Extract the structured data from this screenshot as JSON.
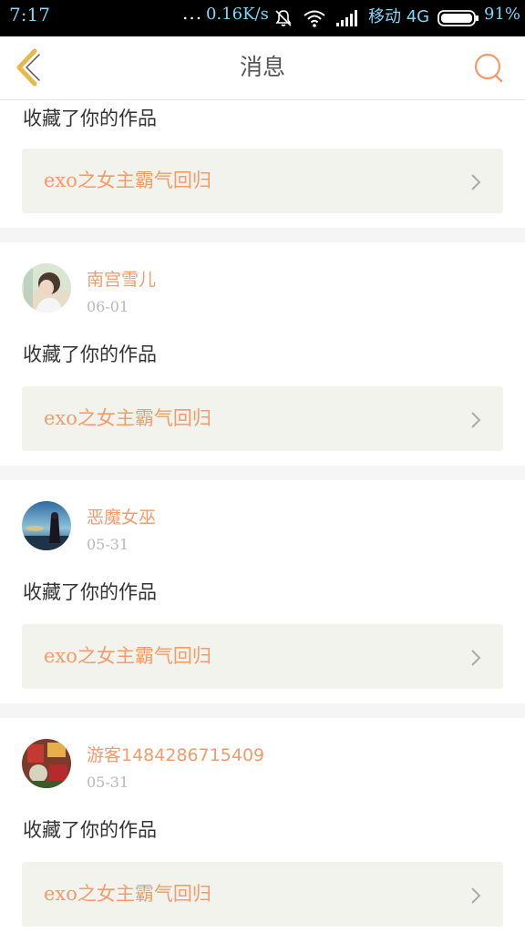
{
  "statusbar": {
    "time": "7:17",
    "dots": "...",
    "speed": "0.16K/s",
    "carrier": "移动 4G",
    "battery": "91%",
    "icons": [
      "mute-icon",
      "wifi-icon",
      "signal-icon",
      "battery-icon"
    ]
  },
  "navbar": {
    "title": "消息",
    "back_icon": "chevron-left-icon",
    "search_icon": "search-icon"
  },
  "colors": {
    "accent": "#f39b6b",
    "back_icon": "#e8b84a",
    "card_bg": "#f3f3ed",
    "separator": "#f5f5f5",
    "statusbar_text": "#7fd6f5"
  },
  "items": [
    {
      "action": "收藏了你的作品",
      "work": "exo之女主霸气回归"
    },
    {
      "name": "南宫雪儿",
      "date": "06-01",
      "action": "收藏了你的作品",
      "work": "exo之女主霸气回归"
    },
    {
      "name": "恶魔女巫",
      "date": "05-31",
      "action": "收藏了你的作品",
      "work": "exo之女主霸气回归"
    },
    {
      "name": "游客1484286715409",
      "date": "05-31",
      "action": "收藏了你的作品",
      "work": "exo之女主霸气回归"
    }
  ]
}
